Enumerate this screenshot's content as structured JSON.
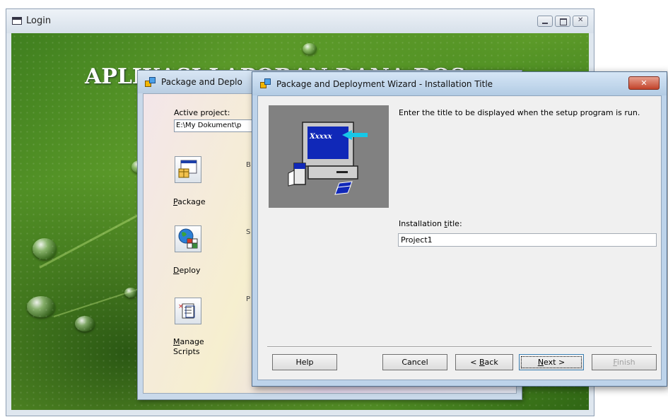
{
  "login_window": {
    "title": "Login",
    "heading": "APLIKASI LAPORAN DANA BOS"
  },
  "wizard_window": {
    "title": "Package and Deplo",
    "active_project_label": "Active project:",
    "active_project_value": "E:\\My Dokument\\p",
    "buttons": [
      {
        "accesskey": "P",
        "rest": "ackage",
        "icon": "package-icon"
      },
      {
        "accesskey": "D",
        "rest": "eploy",
        "icon": "deploy-globe-icon"
      },
      {
        "accesskey": "M",
        "rest": "anage",
        "line2": "Scripts",
        "icon": "manage-scripts-icon"
      }
    ],
    "stub_texts": [
      "B",
      "S",
      "P"
    ]
  },
  "dialog": {
    "title": "Package and Deployment Wizard - Installation Title",
    "instruction": "Enter the title to be displayed when the setup program is run.",
    "illustration_text": "Xxxxx",
    "installation_title_label_pre": "Installation ",
    "installation_title_label_key": "t",
    "installation_title_label_post": "itle:",
    "installation_title_value": "Project1",
    "buttons": {
      "help": "Help",
      "cancel": "Cancel",
      "back_pre": "< ",
      "back_key": "B",
      "back_post": "ack",
      "next_key": "N",
      "next_post": "ext >",
      "finish_key": "F",
      "finish_post": "inish"
    }
  },
  "colors": {
    "dialog_close": "#c2432a",
    "illustration_bg": "#818181",
    "screen_blue": "#1028b8",
    "arrow_cyan": "#16c8e8"
  }
}
